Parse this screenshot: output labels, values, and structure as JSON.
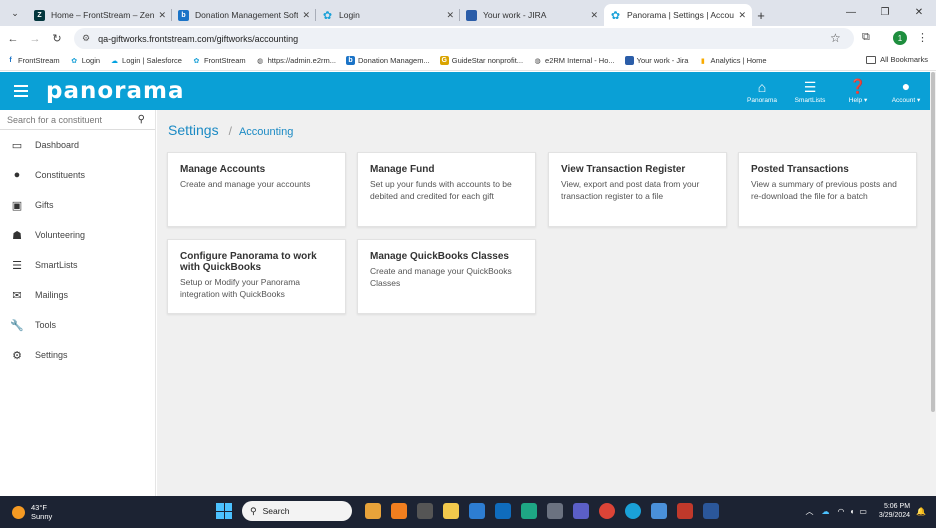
{
  "browser": {
    "tabs": [
      {
        "title": "Home – FrontStream – Zendesk",
        "icon": "zendesk-icon",
        "color": "#03363d",
        "active": false
      },
      {
        "title": "Donation Management Softwa",
        "icon": "b-icon",
        "color": "#1a73c7",
        "active": false
      },
      {
        "title": "Login",
        "icon": "panorama-icon",
        "color": "#1aa1d8",
        "active": false
      },
      {
        "title": "Your work - JIRA",
        "icon": "jira-icon",
        "color": "#2b5da8",
        "active": false
      },
      {
        "title": "Panorama | Settings | Accountin",
        "icon": "panorama-icon",
        "color": "#1aa1d8",
        "active": true
      }
    ],
    "url": "qa-giftworks.frontstream.com/giftworks/accounting",
    "profile_initial": "1",
    "bookmarks": [
      {
        "label": "FrontStream",
        "icon": "fs-icon",
        "color": "#1a73c7"
      },
      {
        "label": "Login",
        "icon": "panorama-icon",
        "color": "#1aa1d8"
      },
      {
        "label": "Login | Salesforce",
        "icon": "salesforce-icon",
        "color": "#00a1e0"
      },
      {
        "label": "FrontStream",
        "icon": "panorama-icon",
        "color": "#1aa1d8"
      },
      {
        "label": "https://admin.e2rm...",
        "icon": "globe-icon",
        "color": "#444444"
      },
      {
        "label": "Donation Managem...",
        "icon": "b-icon",
        "color": "#1a73c7"
      },
      {
        "label": "GuideStar nonprofit...",
        "icon": "guidestar-icon",
        "color": "#d9a400"
      },
      {
        "label": "e2RM Internal - Ho...",
        "icon": "globe-icon",
        "color": "#444444"
      },
      {
        "label": "Your work - Jira",
        "icon": "jira-icon",
        "color": "#2b5da8"
      },
      {
        "label": "Analytics | Home",
        "icon": "analytics-icon",
        "color": "#f9ab00"
      }
    ],
    "all_bookmarks": "All Bookmarks"
  },
  "app": {
    "logo": "panorama",
    "accent": "#0aa0d6",
    "nav": [
      {
        "label": "Panorama",
        "icon": "home-icon"
      },
      {
        "label": "SmartLists",
        "icon": "list-icon"
      },
      {
        "label": "Help ▾",
        "icon": "help-icon"
      },
      {
        "label": "Account ▾",
        "icon": "user-icon"
      }
    ]
  },
  "sidebar": {
    "search_placeholder": "Search for a constituent",
    "items": [
      {
        "label": "Dashboard",
        "icon": "dashboard-icon"
      },
      {
        "label": "Constituents",
        "icon": "person-icon"
      },
      {
        "label": "Gifts",
        "icon": "gift-icon"
      },
      {
        "label": "Volunteering",
        "icon": "volunteer-icon"
      },
      {
        "label": "SmartLists",
        "icon": "list-icon"
      },
      {
        "label": "Mailings",
        "icon": "mail-icon"
      },
      {
        "label": "Tools",
        "icon": "wrench-icon"
      },
      {
        "label": "Settings",
        "icon": "gear-icon"
      }
    ]
  },
  "main": {
    "breadcrumb_root": "Settings",
    "breadcrumb_leaf": "Accounting",
    "cards": [
      {
        "title": "Manage Accounts",
        "desc": "Create and manage your accounts"
      },
      {
        "title": "Manage Fund",
        "desc": "Set up your funds with accounts to be debited and credited for each gift"
      },
      {
        "title": "View Transaction Register",
        "desc": "View, export and post data from your transaction register to a file"
      },
      {
        "title": "Posted Transactions",
        "desc": "View a summary of previous posts and re-download the file for a batch"
      },
      {
        "title": "Configure Panorama to work with QuickBooks",
        "desc": "Setup or Modify your Panorama integration with QuickBooks"
      },
      {
        "title": "Manage QuickBooks Classes",
        "desc": "Create and manage your QuickBooks Classes"
      }
    ]
  },
  "taskbar": {
    "temp": "43°F",
    "condition": "Sunny",
    "search": "Search",
    "time": "5:06 PM",
    "date": "3/29/2024"
  }
}
